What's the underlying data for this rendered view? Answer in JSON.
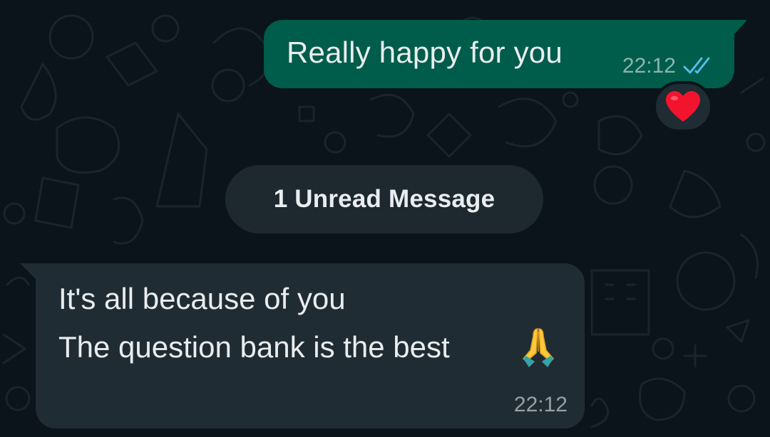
{
  "colors": {
    "background": "#0b141a",
    "outgoing_bubble": "#005c4b",
    "incoming_bubble": "#202c33",
    "unread_pill": "#1d282f",
    "text": "#e9edef",
    "read_ticks": "#53bdeb"
  },
  "messages": {
    "outgoing": {
      "text": "Really happy for you",
      "time": "22:12",
      "status_icon": "double-check-read-icon",
      "reaction": "red-heart-emoji"
    },
    "unread_divider": {
      "label": "1 Unread Message"
    },
    "incoming": {
      "line1": "It's all because of you",
      "line2": "The question bank is the best",
      "emoji": "folded-hands-emoji",
      "time": "22:12"
    }
  }
}
